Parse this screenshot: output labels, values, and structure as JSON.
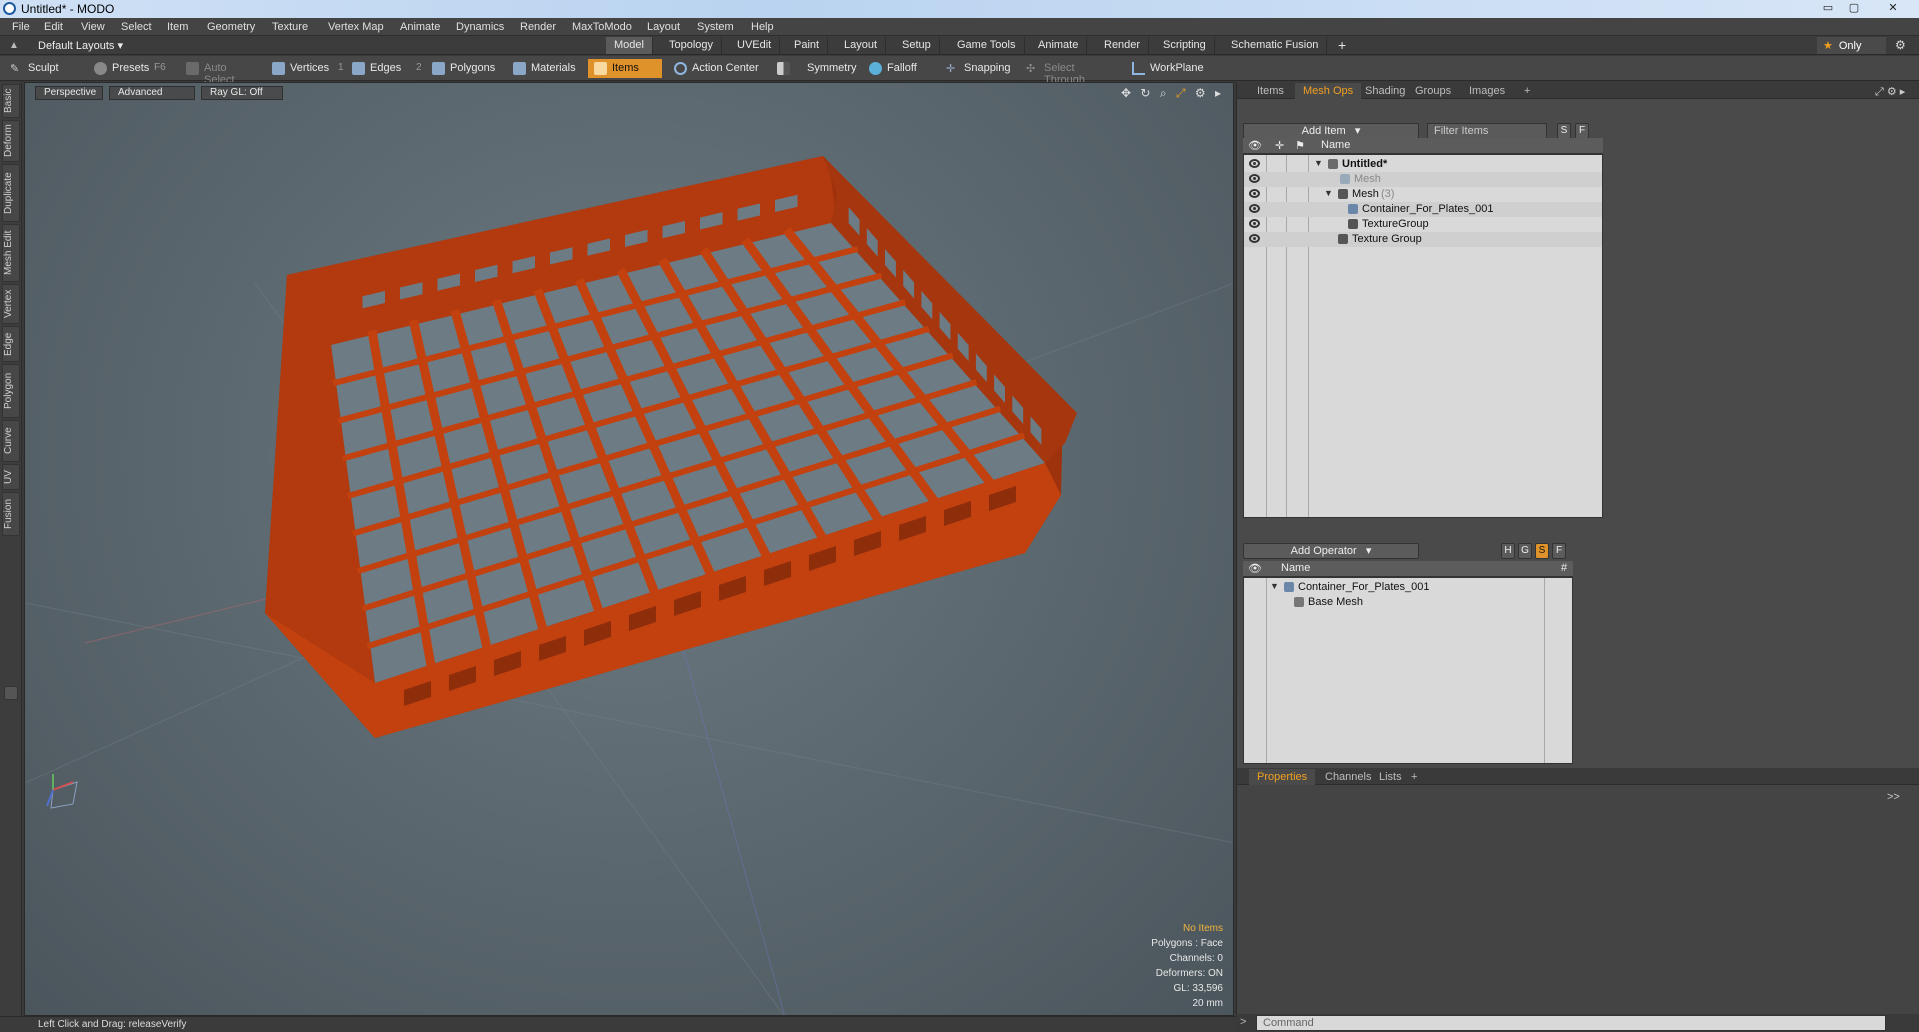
{
  "window": {
    "title": "Untitled* - MODO",
    "min_label": "▭",
    "max_label": "▢",
    "close_label": "✕"
  },
  "menu": [
    "File",
    "Edit",
    "View",
    "Select",
    "Item",
    "Geometry",
    "Texture",
    "Vertex Map",
    "Animate",
    "Dynamics",
    "Render",
    "MaxToModo",
    "Layout",
    "System",
    "Help"
  ],
  "layouts": {
    "label": "Default Layouts ▾"
  },
  "tabs": [
    "Model",
    "Topology",
    "UVEdit",
    "Paint",
    "Layout",
    "Setup",
    "Game Tools",
    "Animate",
    "Render",
    "Scripting",
    "Schematic Fusion"
  ],
  "tabs_active": "Model",
  "tab_add": "+",
  "only_label": "Only",
  "toolbar": {
    "sculpt": "Sculpt",
    "presets": "Presets",
    "presets_key": "F6",
    "auto_select": "Auto Select",
    "vertices": "Vertices",
    "vertices_num": "1",
    "edges": "Edges",
    "edges_num": "2",
    "polygons": "Polygons",
    "materials": "Materials",
    "items": "Items",
    "action_center": "Action Center",
    "symmetry": "Symmetry",
    "falloff": "Falloff",
    "snapping": "Snapping",
    "select_through": "Select Through",
    "workplane": "WorkPlane"
  },
  "left_tabs": [
    "Basic",
    "Deform",
    "Duplicate",
    "Mesh Edit",
    "Vertex",
    "Edge",
    "Polygon",
    "Curve",
    "UV",
    "Fusion"
  ],
  "viewport": {
    "perspective": "Perspective",
    "advanced": "Advanced",
    "raygl": "Ray GL: Off",
    "info": {
      "no_items": "No Items",
      "polygons": "Polygons : Face",
      "channels": "Channels: 0",
      "deformers": "Deformers: ON",
      "gl": "GL: 33,596",
      "scale": "20 mm"
    },
    "mesh_color": "#c2410f"
  },
  "status": {
    "text": "Left Click and Drag:  releaseVerify"
  },
  "items_panel": {
    "tabs": [
      "Items",
      "Mesh Ops",
      "Shading",
      "Groups",
      "Images"
    ],
    "active_tab": "Mesh Ops",
    "add_item": "Add Item",
    "filter": "Filter Items",
    "s_label": "S",
    "f_label": "F",
    "name_header": "Name",
    "rows": [
      {
        "label": "Untitled*",
        "bold": true
      },
      {
        "label": "Mesh",
        "gray": true
      },
      {
        "label": "Mesh",
        "suffix": "(3)"
      },
      {
        "label": "Container_For_Plates_001"
      },
      {
        "label": "TextureGroup"
      },
      {
        "label": "Texture Group"
      }
    ]
  },
  "ops_panel": {
    "add_operator": "Add Operator",
    "name_header": "Name",
    "hash": "#",
    "h_label": "H",
    "g_label": "G",
    "s_label": "S",
    "f_label": "F",
    "rows": [
      {
        "label": "Container_For_Plates_001"
      },
      {
        "label": "Base Mesh"
      }
    ]
  },
  "props_panel": {
    "tabs": [
      "Properties",
      "Channels",
      "Lists"
    ],
    "active_tab": "Properties",
    "expand": ">>"
  },
  "command": {
    "placeholder": "Command"
  }
}
